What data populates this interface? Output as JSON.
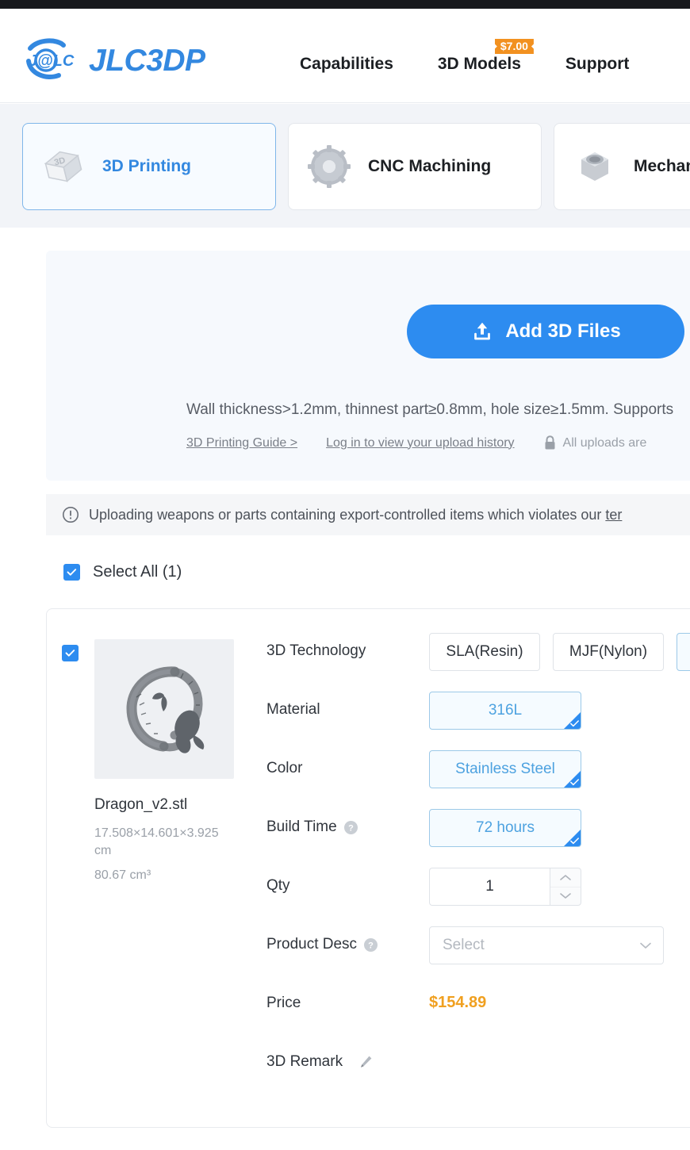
{
  "header": {
    "logo_text": "JLC3DP",
    "logo_mark_text": "J@LC",
    "nav": [
      {
        "label": "Capabilities",
        "badge": null
      },
      {
        "label": "3D Models",
        "badge": "$7.00"
      },
      {
        "label": "Support",
        "badge": null
      }
    ]
  },
  "tabs": [
    {
      "label": "3D Printing",
      "icon": "printer-box-icon",
      "active": true
    },
    {
      "label": "CNC Machining",
      "icon": "gear-icon",
      "active": false
    },
    {
      "label": "Mechanical Parts",
      "icon": "nut-icon",
      "active": false
    }
  ],
  "upload": {
    "button_label": "Add 3D Files",
    "button_icon": "upload-icon",
    "hint": "Wall thickness>1.2mm, thinnest part≥0.8mm, hole size≥1.5mm. Supports",
    "guide_link": "3D Printing Guide >",
    "history_link": "Log in to view your upload history",
    "secure_icon": "lock-icon",
    "secure_text": "All uploads are"
  },
  "warning": {
    "icon": "alert-circle-icon",
    "text": "Uploading weapons or parts containing export-controlled items which violates our ",
    "link_text": "ter"
  },
  "select_all": {
    "label": "Select All (1)",
    "checked": true
  },
  "item": {
    "checked": true,
    "thumbnail_alt": "dragon-model-preview",
    "file_name": "Dragon_v2.stl",
    "dimensions": "17.508×14.601×3.925 cm",
    "volume": "80.67 cm³",
    "rows": {
      "technology": {
        "label": "3D Technology",
        "options": [
          {
            "label": "SLA(Resin)",
            "selected": false
          },
          {
            "label": "MJF(Nylon)",
            "selected": false
          },
          {
            "label": "",
            "selected": true
          }
        ]
      },
      "material": {
        "label": "Material",
        "options": [
          {
            "label": "316L",
            "selected": true
          }
        ]
      },
      "color": {
        "label": "Color",
        "options": [
          {
            "label": "Stainless Steel",
            "selected": true
          }
        ]
      },
      "build_time": {
        "label": "Build Time",
        "help": "help-icon",
        "options": [
          {
            "label": "72 hours",
            "selected": true
          }
        ]
      },
      "qty": {
        "label": "Qty",
        "value": "1",
        "up_icon": "chevron-up-icon",
        "down_icon": "chevron-down-icon"
      },
      "product_desc": {
        "label": "Product Desc",
        "help": "help-icon",
        "placeholder": "Select",
        "caret_icon": "chevron-down-icon"
      },
      "price": {
        "label": "Price",
        "value": "$154.89"
      },
      "remark": {
        "label": "3D Remark",
        "edit_icon": "pencil-icon"
      }
    }
  },
  "colors": {
    "brand_blue": "#2d8cf0",
    "logo_blue": "#3388e0",
    "badge_orange": "#f29120",
    "price_orange": "#f0a020",
    "panel_bg": "#f6f9fd",
    "band_bg": "#f2f4f8",
    "dark_strip": "#17181c"
  }
}
